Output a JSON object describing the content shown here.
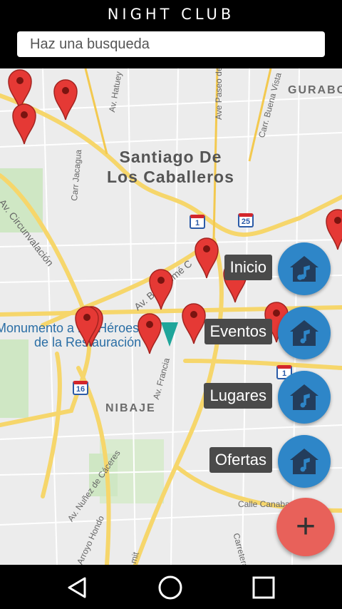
{
  "app": {
    "title": "NIGHT CLUB"
  },
  "search": {
    "placeholder": "Haz una busqueda",
    "value": ""
  },
  "map": {
    "city_line1": "Santiago De",
    "city_line2": "Los Caballeros",
    "area_gurabo": "GURABO",
    "area_nibaje": "NIBAJE",
    "poi_line1": "Monumento a los Héroes",
    "poi_line2": "de la Restauración",
    "streets": {
      "hatuey": "Av. Hatuey",
      "paseo": "Ave Paseo de",
      "buena_vista": "Carr. Buena Vista",
      "jacagua": "Carr Jacagua",
      "circunvalacion": "Av. Circunvalación",
      "bartolome": "Av. Bartolomé C",
      "francia": "Av. Francia",
      "caceres": "Av. Nuñez de Cáceres",
      "arroyo": "Arroyo Hondo",
      "canabacoa": "Calle Canabacoa",
      "carretera": "Carretera",
      "mit": "mit"
    },
    "highways": [
      "1",
      "25",
      "1",
      "16"
    ]
  },
  "menu": [
    {
      "label": "Inicio",
      "icon": "music-house-icon"
    },
    {
      "label": "Eventos",
      "icon": "music-house-icon"
    },
    {
      "label": "Lugares",
      "icon": "music-house-icon"
    },
    {
      "label": "Ofertas",
      "icon": "music-house-icon"
    }
  ],
  "fab": {
    "main_icon": "+"
  },
  "colors": {
    "fab_blue": "#2e86c8",
    "fab_red": "#e8615a",
    "pin_red": "#e53935",
    "label_bg": "#4a4a4a"
  }
}
